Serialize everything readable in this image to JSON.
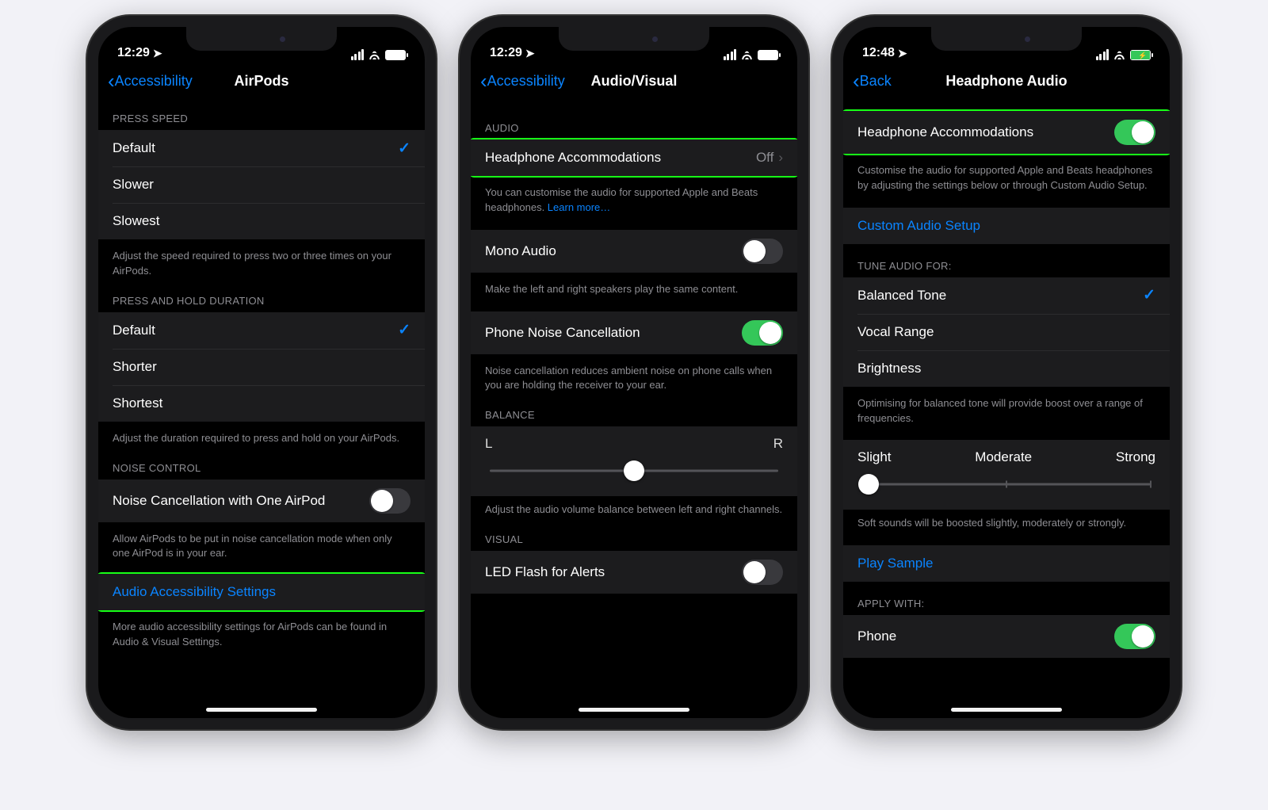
{
  "screen1": {
    "status": {
      "time": "12:29",
      "charging": false
    },
    "nav": {
      "back": "Accessibility",
      "title": "AirPods"
    },
    "pressSpeedHeader": "PRESS SPEED",
    "pressSpeed": [
      "Default",
      "Slower",
      "Slowest"
    ],
    "pressSpeedSelected": 0,
    "pressSpeedFooter": "Adjust the speed required to press two or three times on your AirPods.",
    "holdHeader": "PRESS AND HOLD DURATION",
    "hold": [
      "Default",
      "Shorter",
      "Shortest"
    ],
    "holdSelected": 0,
    "holdFooter": "Adjust the duration required to press and hold on your AirPods.",
    "noiseHeader": "NOISE CONTROL",
    "noiseLabel": "Noise Cancellation with One AirPod",
    "noiseOn": false,
    "noiseFooter": "Allow AirPods to be put in noise cancellation mode when only one AirPod is in your ear.",
    "audioLink": "Audio Accessibility Settings",
    "audioFooter": "More audio accessibility settings for AirPods can be found in Audio & Visual Settings."
  },
  "screen2": {
    "status": {
      "time": "12:29",
      "charging": false
    },
    "nav": {
      "back": "Accessibility",
      "title": "Audio/Visual"
    },
    "audioHeader": "AUDIO",
    "headphone": {
      "label": "Headphone Accommodations",
      "value": "Off"
    },
    "headphoneFooter": "You can customise the audio for supported Apple and Beats headphones. ",
    "learnMore": "Learn more…",
    "monoLabel": "Mono Audio",
    "monoOn": false,
    "monoFooter": "Make the left and right speakers play the same content.",
    "pncLabel": "Phone Noise Cancellation",
    "pncOn": true,
    "pncFooter": "Noise cancellation reduces ambient noise on phone calls when you are holding the receiver to your ear.",
    "balanceHeader": "BALANCE",
    "balanceL": "L",
    "balanceR": "R",
    "balancePos": 50,
    "balanceFooter": "Adjust the audio volume balance between left and right channels.",
    "visualHeader": "VISUAL",
    "ledLabel": "LED Flash for Alerts",
    "ledOn": false
  },
  "screen3": {
    "status": {
      "time": "12:48",
      "charging": true
    },
    "nav": {
      "back": "Back",
      "title": "Headphone Audio"
    },
    "accomLabel": "Headphone Accommodations",
    "accomOn": true,
    "accomFooter": "Customise the audio for supported Apple and Beats headphones by adjusting the settings below or through Custom Audio Setup.",
    "customSetup": "Custom Audio Setup",
    "tuneHeader": "TUNE AUDIO FOR:",
    "tune": [
      "Balanced Tone",
      "Vocal Range",
      "Brightness"
    ],
    "tuneSelected": 0,
    "tuneFooter": "Optimising for balanced tone will provide boost over a range of frequencies.",
    "levelLabels": [
      "Slight",
      "Moderate",
      "Strong"
    ],
    "levelPos": 0,
    "levelFooter": "Soft sounds will be boosted slightly, moderately or strongly.",
    "playSample": "Play Sample",
    "applyHeader": "APPLY WITH:",
    "phoneLabel": "Phone",
    "phoneOn": true
  }
}
